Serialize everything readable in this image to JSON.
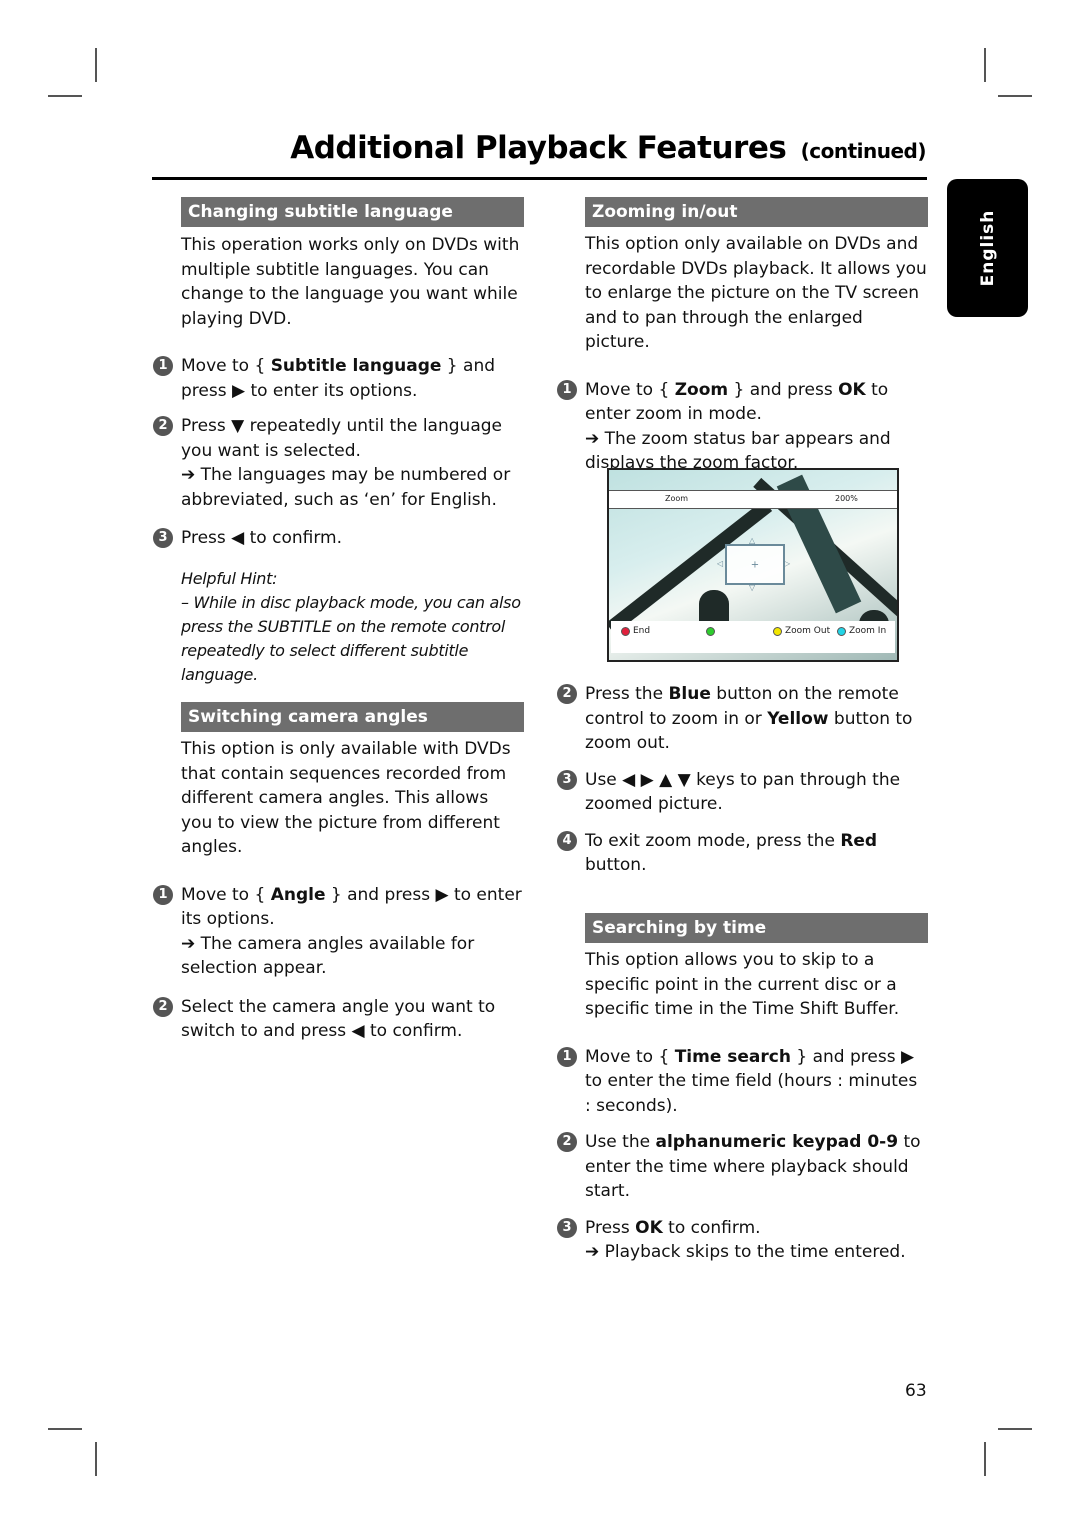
{
  "page": {
    "title": "Additional Playback Features",
    "title_suffix": "(continued)",
    "language_tab": "English",
    "page_number": "63"
  },
  "left": {
    "subtitle": {
      "heading": "Changing subtitle language",
      "intro": "This operation works only on DVDs with multiple subtitle languages. You can change to the language you want while playing DVD.",
      "steps": [
        {
          "num": "1",
          "pre": "Move to { ",
          "bold": "Subtitle language",
          "post": " } and press ▶ to enter its options."
        },
        {
          "num": "2",
          "text": "Press ▼ repeatedly until the language you want is selected.",
          "result": "➔ The languages may be numbered or abbreviated, such as ‘en’ for English."
        },
        {
          "num": "3",
          "text": "Press ◀ to confirm."
        }
      ],
      "hint_title": "Helpful Hint:",
      "hint_text": "–  While in disc playback mode, you can also press the SUBTITLE on the remote control repeatedly to select different subtitle language."
    },
    "angles": {
      "heading": "Switching camera angles",
      "intro": "This option is only available with DVDs that contain sequences recorded from different camera angles. This allows you to view the picture from different angles.",
      "steps": [
        {
          "num": "1",
          "pre": "Move to { ",
          "bold": "Angle",
          "post": " } and press ▶ to enter its options.",
          "result": "➔ The camera angles available for selection appear."
        },
        {
          "num": "2",
          "text": "Select the camera angle you want to switch to and press ◀ to confirm."
        }
      ]
    }
  },
  "right": {
    "zoom": {
      "heading": "Zooming in/out",
      "intro": "This option only available on DVDs and recordable DVDs playback.  It allows you to enlarge the picture on the TV screen and to pan through the enlarged picture.",
      "step1": {
        "num": "1",
        "pre": "Move to { ",
        "bold": "Zoom",
        "mid": " } and press ",
        "bold2": "OK",
        "post": " to enter zoom in mode.",
        "result": "➔ The zoom status bar appears and displays the zoom factor."
      },
      "screen": {
        "zoom_label": "Zoom",
        "zoom_value": "200%",
        "buttons": [
          {
            "color": "#e0203c",
            "label": "End"
          },
          {
            "color": "#2ecc2e",
            "label": ""
          },
          {
            "color": "#f2e600",
            "label": "Zoom Out"
          },
          {
            "color": "#22d4e6",
            "label": "Zoom In"
          }
        ]
      },
      "step2": {
        "num": "2",
        "a": "Press the ",
        "b1": "Blue",
        "c": " button on the remote control to zoom in or ",
        "b2": "Yellow",
        "d": " button to zoom out."
      },
      "step3": {
        "num": "3",
        "text": "Use ◀ ▶ ▲ ▼ keys to pan through the zoomed picture."
      },
      "step4": {
        "num": "4",
        "pre": "To exit zoom mode, press the ",
        "bold": "Red",
        "post": " button."
      }
    },
    "time": {
      "heading": "Searching by time",
      "intro": "This option allows you to skip to a specific point in the current disc or a specific time in the Time Shift Buffer.",
      "step1": {
        "num": "1",
        "pre": "Move to { ",
        "bold": "Time search",
        "post": " } and press ▶ to enter the time field (hours : minutes : seconds)."
      },
      "step2": {
        "num": "2",
        "pre": "Use the ",
        "bold": "alphanumeric keypad 0-9",
        "post": " to enter the time where playback should start."
      },
      "step3": {
        "num": "3",
        "pre": "Press ",
        "bold": "OK",
        "post": " to confirm.",
        "result": "➔ Playback skips to the time entered."
      }
    }
  }
}
